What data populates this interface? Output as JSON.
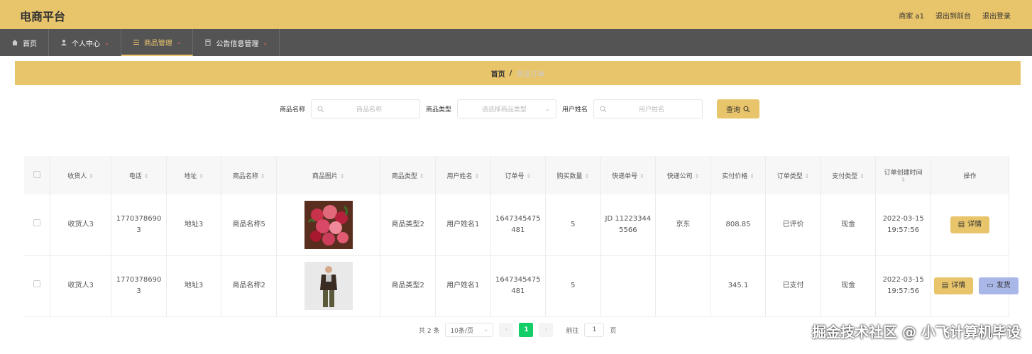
{
  "app": {
    "title": "电商平台"
  },
  "top_links": {
    "user": "商家 a1",
    "goto_front": "退出到前台",
    "logout": "退出登录"
  },
  "nav": [
    {
      "label": "首页",
      "icon": "home-icon"
    },
    {
      "label": "个人中心",
      "icon": "user-icon"
    },
    {
      "label": "商品管理",
      "icon": "list-icon"
    },
    {
      "label": "公告信息管理",
      "icon": "notice-icon"
    }
  ],
  "breadcrumb": {
    "home": "首页",
    "sep": "/",
    "current": "商品订单"
  },
  "search": {
    "name_label": "商品名称",
    "name_placeholder": "商品名称",
    "type_label": "商品类型",
    "type_placeholder": "请选择商品类型",
    "user_label": "用户姓名",
    "user_placeholder": "用户姓名",
    "button": "查询"
  },
  "table": {
    "headers": [
      "收货人",
      "电话",
      "地址",
      "商品名称",
      "商品图片",
      "商品类型",
      "用户姓名",
      "订单号",
      "购买数量",
      "快递单号",
      "快递公司",
      "实付价格",
      "订单类型",
      "支付类型",
      "订单创建时间",
      "操作"
    ],
    "rows": [
      {
        "receiver": "收货人3",
        "phone": "17703786903",
        "address": "地址3",
        "name": "商品名称5",
        "type": "商品类型2",
        "user": "用户姓名1",
        "order_no": "1647345475481",
        "qty": "5",
        "tracking": "JD 112233445566",
        "courier": "京东",
        "price": "808.85",
        "order_type": "已评价",
        "pay_type": "现金",
        "created": "2022-03-15 19:57:56",
        "image": "flower-bouquet"
      },
      {
        "receiver": "收货人3",
        "phone": "17703786903",
        "address": "地址3",
        "name": "商品名称2",
        "type": "商品类型2",
        "user": "用户姓名1",
        "order_no": "1647345475481",
        "qty": "5",
        "tracking": "",
        "courier": "",
        "price": "345.1",
        "order_type": "已支付",
        "pay_type": "现金",
        "created": "2022-03-15 19:57:56",
        "image": "man-in-jacket"
      }
    ],
    "actions": {
      "detail": "详情",
      "ship": "发货"
    }
  },
  "pagination": {
    "total": "共 2 条",
    "page_size": "10条/页",
    "current": "1",
    "goto_label": "前往",
    "goto_value": "1",
    "page_unit": "页"
  },
  "watermark": "掘金技术社区 @ 小飞计算机毕设",
  "colors": {
    "accent": "#e8c46b",
    "nav_bg": "#545454",
    "ship_button": "#a9b7e8",
    "page_active": "#13ce66"
  }
}
